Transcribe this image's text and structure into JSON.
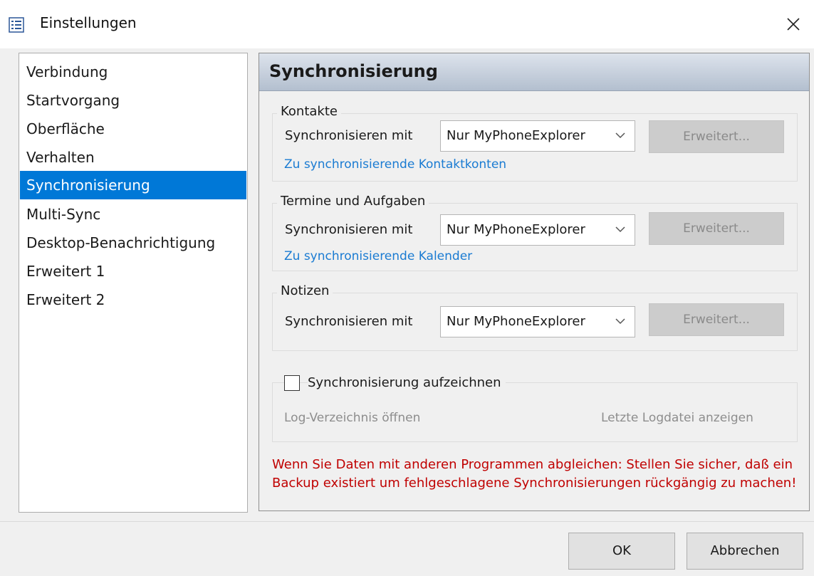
{
  "window": {
    "title": "Einstellungen",
    "icon": "settings-list-icon",
    "close_icon": "close-icon"
  },
  "nav": {
    "items": [
      {
        "label": "Verbindung",
        "selected": false
      },
      {
        "label": "Startvorgang",
        "selected": false
      },
      {
        "label": "Oberfläche",
        "selected": false
      },
      {
        "label": "Verhalten",
        "selected": false
      },
      {
        "label": "Synchronisierung",
        "selected": true
      },
      {
        "label": "Multi-Sync",
        "selected": false
      },
      {
        "label": "Desktop-Benachrichtigung",
        "selected": false
      },
      {
        "label": "Erweitert 1",
        "selected": false
      },
      {
        "label": "Erweitert 2",
        "selected": false
      }
    ]
  },
  "panel": {
    "title": "Synchronisierung",
    "groups": [
      {
        "label": "Kontakte",
        "sync_label": "Synchronisieren mit",
        "selected_value": "Nur MyPhoneExplorer",
        "advanced_label": "Erweitert...",
        "link_label": "Zu synchronisierende Kontaktkonten"
      },
      {
        "label": "Termine und Aufgaben",
        "sync_label": "Synchronisieren mit",
        "selected_value": "Nur MyPhoneExplorer",
        "advanced_label": "Erweitert...",
        "link_label": "Zu synchronisierende Kalender"
      },
      {
        "label": "Notizen",
        "sync_label": "Synchronisieren mit",
        "selected_value": "Nur MyPhoneExplorer",
        "advanced_label": "Erweitert..."
      }
    ],
    "log": {
      "checkbox_label": "Synchronisierung aufzeichnen",
      "checked": false,
      "open_dir_label": "Log-Verzeichnis öffnen",
      "show_last_label": "Letzte Logdatei anzeigen"
    },
    "warning": "Wenn Sie Daten mit anderen Programmen abgleichen: Stellen Sie sicher, daß ein Backup existiert um fehlgeschlagene Synchronisierungen rückgängig zu machen!"
  },
  "buttons": {
    "ok": "OK",
    "cancel": "Abbrechen"
  },
  "colors": {
    "selection": "#0078d7",
    "link": "#1a7bd2",
    "warning": "#c00000"
  }
}
